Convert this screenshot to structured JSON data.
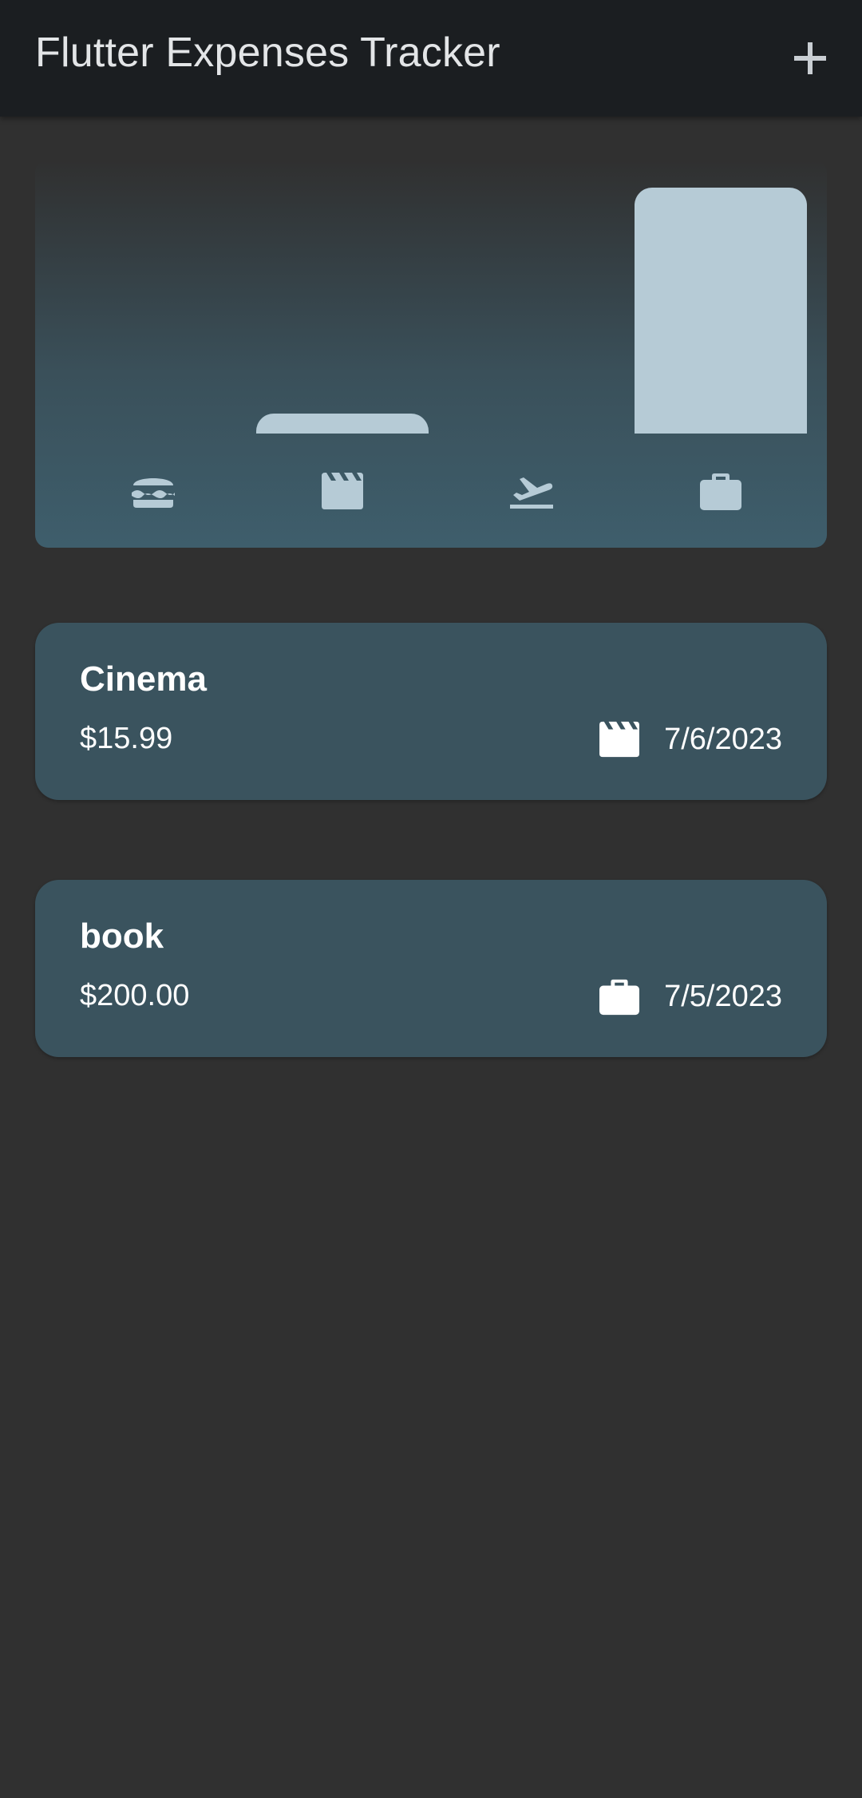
{
  "app_bar": {
    "title": "Flutter Expenses Tracker",
    "add_icon": "plus-icon"
  },
  "chart": {
    "colors": {
      "bar": "#b6cbd6",
      "icon": "#b6cbd6"
    }
  },
  "chart_data": {
    "type": "bar",
    "categories": [
      "food",
      "leisure",
      "travel",
      "work"
    ],
    "category_icons": [
      "hamburger-icon",
      "movie-clapper-icon",
      "flight-takeoff-icon",
      "briefcase-icon"
    ],
    "values": [
      0,
      15.99,
      0,
      200.0
    ],
    "ylim": [
      0,
      200.0
    ],
    "grid": false,
    "title": "",
    "xlabel": "",
    "ylabel": ""
  },
  "expenses": [
    {
      "title": "Cinema",
      "amount": "$15.99",
      "category_icon": "movie-clapper-icon",
      "date": "7/6/2023"
    },
    {
      "title": "book",
      "amount": "$200.00",
      "category_icon": "briefcase-icon",
      "date": "7/5/2023"
    }
  ],
  "colors": {
    "background": "#303030",
    "app_bar": "#1b1e21",
    "card": "#3a535e",
    "text": "#ffffff"
  }
}
